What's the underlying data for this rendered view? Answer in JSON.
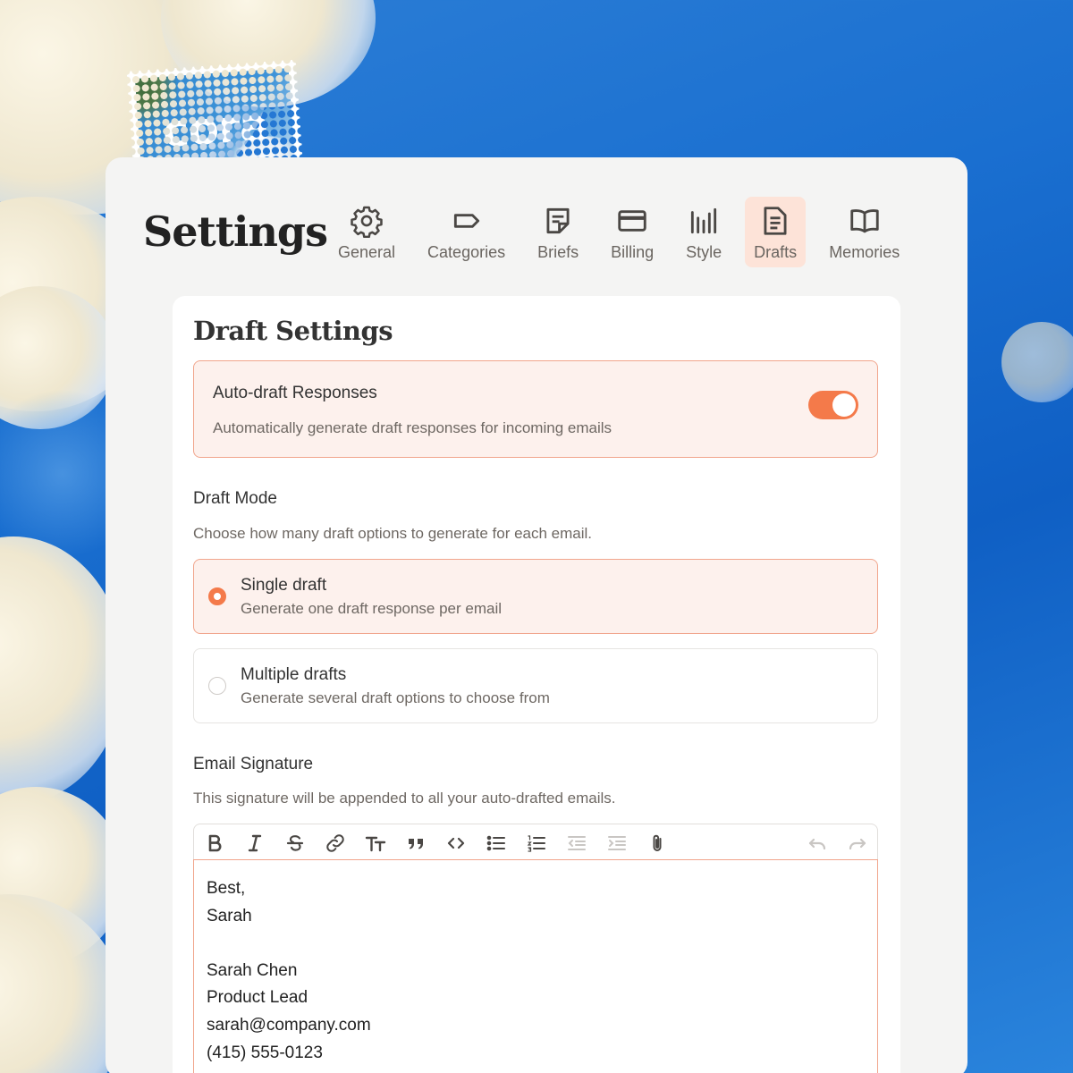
{
  "brand": {
    "logo_text": "cora"
  },
  "header": {
    "title": "Settings"
  },
  "tabs": [
    {
      "label": "General",
      "icon": "gear-icon"
    },
    {
      "label": "Categories",
      "icon": "tag-icon"
    },
    {
      "label": "Briefs",
      "icon": "note-icon"
    },
    {
      "label": "Billing",
      "icon": "credit-card-icon"
    },
    {
      "label": "Style",
      "icon": "bars-icon"
    },
    {
      "label": "Drafts",
      "icon": "document-icon",
      "active": true
    },
    {
      "label": "Memories",
      "icon": "book-icon"
    }
  ],
  "card": {
    "title": "Draft Settings",
    "auto_draft": {
      "title": "Auto-draft Responses",
      "description": "Automatically generate draft responses for incoming emails",
      "enabled": true
    },
    "draft_mode": {
      "label": "Draft Mode",
      "description": "Choose how many draft options to generate for each email.",
      "options": [
        {
          "title": "Single draft",
          "description": "Generate one draft response per email",
          "selected": true
        },
        {
          "title": "Multiple drafts",
          "description": "Generate several draft options to choose from",
          "selected": false
        }
      ]
    },
    "signature": {
      "label": "Email Signature",
      "description": "This signature will be appended to all your auto-drafted emails.",
      "lines": [
        "Best,",
        "Sarah",
        "",
        "Sarah Chen",
        "Product Lead",
        "sarah@company.com",
        "(415) 555-0123"
      ]
    },
    "toolbar": [
      "bold-icon",
      "italic-icon",
      "strikethrough-icon",
      "link-icon",
      "text-size-icon",
      "quote-icon",
      "code-icon",
      "bulleted-list-icon",
      "numbered-list-icon",
      "outdent-icon",
      "indent-icon",
      "attachment-icon",
      "undo-icon",
      "redo-icon"
    ]
  },
  "colors": {
    "accent": "#f47a4a",
    "accent_bg": "#fdf1ed",
    "accent_border": "#f1a58c",
    "sky": "#1a6fd0"
  }
}
